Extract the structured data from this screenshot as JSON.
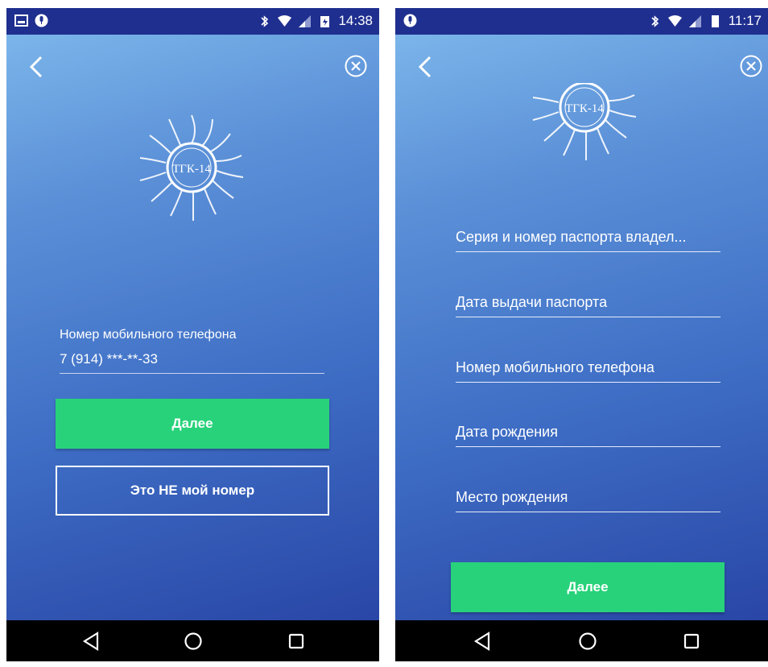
{
  "left_screen": {
    "status_bar": {
      "time": "14:38",
      "left_icons": [
        "gallery-icon",
        "mic-icon"
      ],
      "right_icons": [
        "bluetooth-icon",
        "wifi-icon",
        "signal-icon",
        "battery-icon"
      ]
    },
    "logo_text": "ТГК-14",
    "phone_label": "Номер мобильного телефона",
    "phone_value": "7 (914) ***-**-33",
    "next_button": "Далее",
    "not_my_number_button": "Это НЕ мой номер"
  },
  "right_screen": {
    "status_bar": {
      "time": "11:17",
      "left_icons": [
        "mic-icon"
      ],
      "right_icons": [
        "bluetooth-icon",
        "wifi-icon",
        "signal-icon",
        "battery-icon"
      ]
    },
    "logo_text": "ТГК-14",
    "fields": [
      {
        "placeholder": "Серия и номер паспорта владел..."
      },
      {
        "placeholder": "Дата выдачи паспорта"
      },
      {
        "placeholder": "Номер мобильного телефона"
      },
      {
        "placeholder": "Дата рождения"
      },
      {
        "placeholder": "Место рождения"
      }
    ],
    "next_button": "Далее"
  },
  "nav_bar_icons": [
    "back-triangle-icon",
    "home-circle-icon",
    "recents-square-icon"
  ],
  "colors": {
    "status_bar": "#1f2f8f",
    "gradient_top": "#7bb5ea",
    "gradient_bottom": "#2946a6",
    "button_green": "#28d27a",
    "nav_bar": "#000000"
  }
}
